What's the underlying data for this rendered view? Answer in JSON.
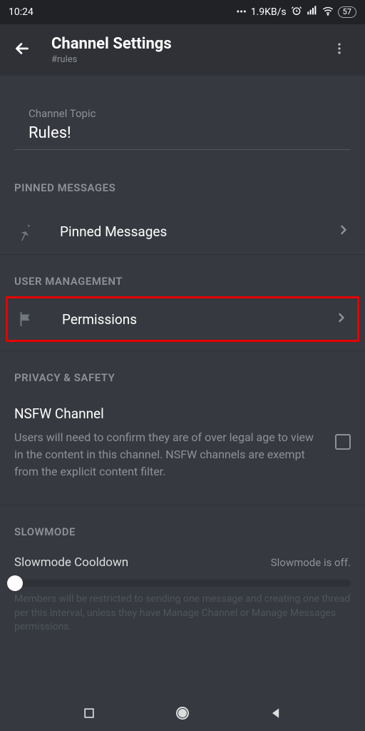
{
  "statusBar": {
    "time": "10:24",
    "netSpeed": "1.9KB/s",
    "battery": "57"
  },
  "header": {
    "title": "Channel Settings",
    "subtitle": "#rules"
  },
  "topic": {
    "label": "Channel Topic",
    "value": "Rules!"
  },
  "sections": {
    "pinned": {
      "header": "PINNED MESSAGES",
      "item": "Pinned Messages"
    },
    "userMgmt": {
      "header": "USER MANAGEMENT",
      "item": "Permissions"
    },
    "privacy": {
      "header": "PRIVACY & SAFETY",
      "nsfwTitle": "NSFW Channel",
      "nsfwDesc": "Users will need to confirm they are of over legal age to view in the content in this channel. NSFW channels are exempt from the explicit content filter."
    },
    "slowmode": {
      "header": "SLOWMODE",
      "title": "Slowmode Cooldown",
      "status": "Slowmode is off.",
      "desc": "Members will be restricted to sending one message and creating one thread per this interval, unless they have Manage Channel or Manage Messages permissions."
    }
  }
}
